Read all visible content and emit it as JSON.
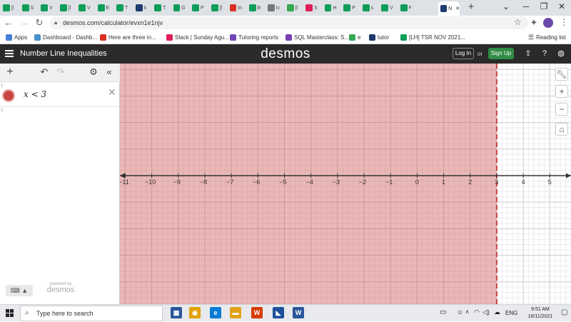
{
  "browser": {
    "tabs": [
      {
        "label": "[l",
        "icon": "sheets-icon",
        "color": "#0f9d58"
      },
      {
        "label": "S",
        "icon": "sheets-icon",
        "color": "#0f9d58"
      },
      {
        "label": "V",
        "icon": "sheets-icon",
        "color": "#0f9d58"
      },
      {
        "label": "[l",
        "icon": "sheets-icon",
        "color": "#0f9d58"
      },
      {
        "label": "V",
        "icon": "sheets-icon",
        "color": "#0f9d58"
      },
      {
        "label": "E",
        "icon": "sheets-icon",
        "color": "#0f9d58"
      },
      {
        "label": "T",
        "icon": "sheets-icon",
        "color": "#0f9d58"
      },
      {
        "label": "ti",
        "icon": "notion-icon",
        "color": "#1e3a6e"
      },
      {
        "label": "T",
        "icon": "sheets-icon",
        "color": "#0f9d58"
      },
      {
        "label": "G",
        "icon": "sheets-icon",
        "color": "#0f9d58"
      },
      {
        "label": "P",
        "icon": "sheets-icon",
        "color": "#0f9d58"
      },
      {
        "label": "[l",
        "icon": "sheets-icon",
        "color": "#0f9d58"
      },
      {
        "label": "In",
        "icon": "gmail-icon",
        "color": "#d93025"
      },
      {
        "label": "B",
        "icon": "sheets-icon",
        "color": "#0f9d58"
      },
      {
        "label": "Ic",
        "icon": "globe-icon",
        "color": "#777777"
      },
      {
        "label": "(l",
        "icon": "green-circle-icon",
        "color": "#34a853"
      },
      {
        "label": "S",
        "icon": "slack-icon",
        "color": "#e01e5a"
      },
      {
        "label": "H",
        "icon": "sheets-icon",
        "color": "#0f9d58"
      },
      {
        "label": "P",
        "icon": "sheets-icon",
        "color": "#0f9d58"
      },
      {
        "label": "s",
        "icon": "sheets-icon",
        "color": "#0f9d58"
      },
      {
        "label": "V",
        "icon": "sheets-icon",
        "color": "#0f9d58"
      },
      {
        "label": "F",
        "icon": "sheets-icon",
        "color": "#0f9d58"
      }
    ],
    "active_tab": {
      "label": "N",
      "close": "✕"
    },
    "new_tab": "+",
    "window_controls": {
      "minimize": "⌄",
      "restore": "─",
      "maximize": "❐",
      "close": "✕"
    },
    "url": "desmos.com/calculator/evxn1e1njv",
    "bookmarks": [
      {
        "label": "Apps",
        "icon": "apps-grid-icon",
        "color": "#4a7ed8"
      },
      {
        "label": "Dashboard - Dashb...",
        "icon": "dashboard-icon",
        "color": "#4a90c8"
      },
      {
        "label": "Here are three in...",
        "icon": "gmail-icon",
        "color": "#d93025"
      },
      {
        "label": "Slack | Sunday Agu...",
        "icon": "slack-icon",
        "color": "#e01e5a"
      },
      {
        "label": "Tutoring reports",
        "icon": "forms-icon",
        "color": "#7248b9"
      },
      {
        "label": "SQL Masterclass: S...",
        "icon": "sql-icon",
        "color": "#7b3fb0"
      },
      {
        "label": "e",
        "icon": "e-icon",
        "color": "#34a853"
      },
      {
        "label": "tutor",
        "icon": "notion-icon",
        "color": "#1e3a6e"
      },
      {
        "label": "[LH] TSR NOV 2021...",
        "icon": "sheets-icon",
        "color": "#0f9d58"
      }
    ],
    "reading_list": "Reading list"
  },
  "desmos": {
    "graph_title": "Number Line Inequalities",
    "logo": "desmos",
    "login": "Log In",
    "or": "or",
    "signup": "Sign Up",
    "expressions": [
      {
        "index": "1",
        "latex": "x < 3",
        "color": "#c74440"
      },
      {
        "index": "2",
        "latex": ""
      }
    ],
    "powered_by": "powered by",
    "powered_logo": "desmos"
  },
  "chart_data": {
    "type": "area",
    "title": "",
    "xlabel": "",
    "ylabel": "",
    "xlim": [
      -11.2,
      5.8
    ],
    "x_ticks": [
      -11,
      -10,
      -9,
      -8,
      -7,
      -6,
      -5,
      -4,
      -3,
      -2,
      -1,
      0,
      1,
      2,
      3,
      4,
      5
    ],
    "grid": true,
    "inequality": "x < 3",
    "boundary_x": 3,
    "boundary_style": "dashed",
    "shade_color": "#c74440",
    "shaded_side": "left"
  },
  "taskbar": {
    "search_placeholder": "Type here to search",
    "apps": [
      {
        "label": "▦",
        "icon": "calculator-icon",
        "color": "#2b579a"
      },
      {
        "label": "◉",
        "icon": "chrome-icon",
        "color": "#e2a100"
      },
      {
        "label": "e",
        "icon": "edge-icon",
        "color": "#0c7bd5"
      },
      {
        "label": "▬",
        "icon": "file-explorer-icon",
        "color": "#e3a21a"
      },
      {
        "label": "W",
        "icon": "wps-icon",
        "color": "#d83b01"
      },
      {
        "label": "◣",
        "icon": "photos-icon",
        "color": "#1e4f9c"
      },
      {
        "label": "W",
        "icon": "word-icon",
        "color": "#2b579a"
      }
    ],
    "language": "ENG",
    "time": "9:51 AM",
    "date": "16/11/2021"
  }
}
